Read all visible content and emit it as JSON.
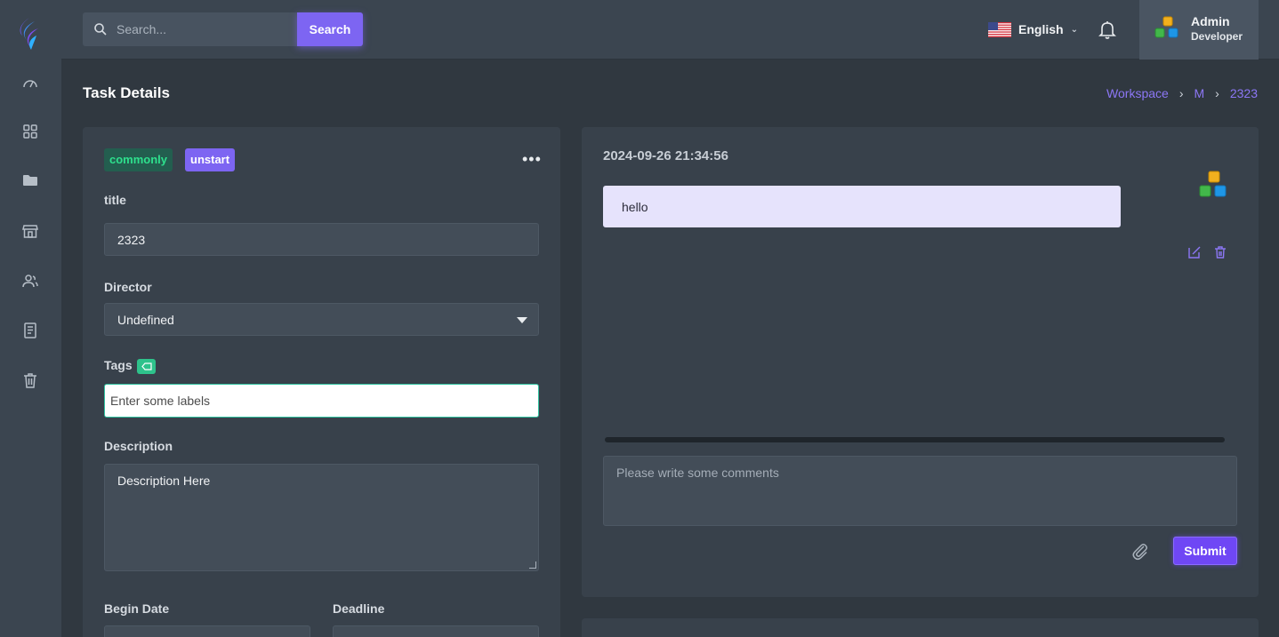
{
  "topbar": {
    "search_placeholder": "Search...",
    "search_button": "Search",
    "language": "English",
    "user": {
      "name": "Admin",
      "role": "Developer"
    }
  },
  "sidebar": {
    "items": [
      {
        "icon": "dashboard-gauge-icon"
      },
      {
        "icon": "grid-icon"
      },
      {
        "icon": "folder-icon"
      },
      {
        "icon": "store-icon"
      },
      {
        "icon": "users-icon"
      },
      {
        "icon": "document-icon"
      },
      {
        "icon": "trash-icon"
      }
    ]
  },
  "page": {
    "title": "Task Details",
    "breadcrumb": [
      "Workspace",
      "M",
      "2323"
    ]
  },
  "task": {
    "badges": {
      "priority": "commonly",
      "status": "unstart"
    },
    "title_label": "title",
    "title_value": "2323",
    "director_label": "Director",
    "director_value": "Undefined",
    "tags_label": "Tags",
    "tags_placeholder": "Enter some labels",
    "description_label": "Description",
    "description_value": "Description Here",
    "begin_date_label": "Begin Date",
    "deadline_label": "Deadline"
  },
  "comments": {
    "items": [
      {
        "timestamp": "2024-09-26 21:34:56",
        "text": "hello"
      }
    ],
    "input_placeholder": "Please write some comments",
    "submit_label": "Submit"
  },
  "colors": {
    "accent": "#7d65f2",
    "submit": "#6f47f5",
    "success_badge_text": "#2ee08d",
    "tag_icon": "#2ec28b"
  }
}
